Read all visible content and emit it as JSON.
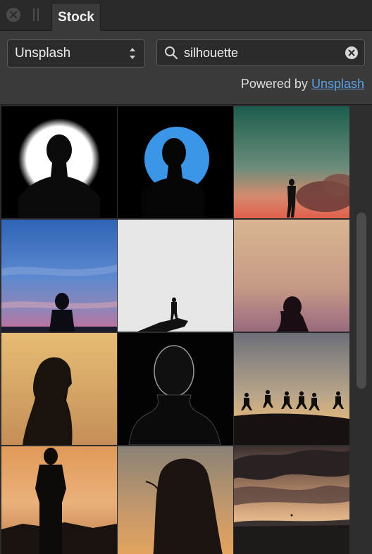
{
  "tab": {
    "title": "Stock"
  },
  "source_select": {
    "value": "Unsplash"
  },
  "search": {
    "value": "silhouette"
  },
  "powered": {
    "text": "Powered by",
    "link": "Unsplash"
  },
  "thumbnails": [
    "portrait-white-circle",
    "portrait-blue-circle",
    "person-standing-teal-sky",
    "person-blue-sky",
    "person-on-rock-white",
    "woman-dusk-sky",
    "woman-profile-sunset",
    "man-backlit-dark",
    "people-jumping-sunset",
    "man-standing-sunset",
    "woman-hair-sunset",
    "cloudy-sea-sunset"
  ],
  "colors": {
    "link": "#5aa0e6",
    "panel": "#3a3a3a",
    "tabbar": "#2a2a2a"
  }
}
